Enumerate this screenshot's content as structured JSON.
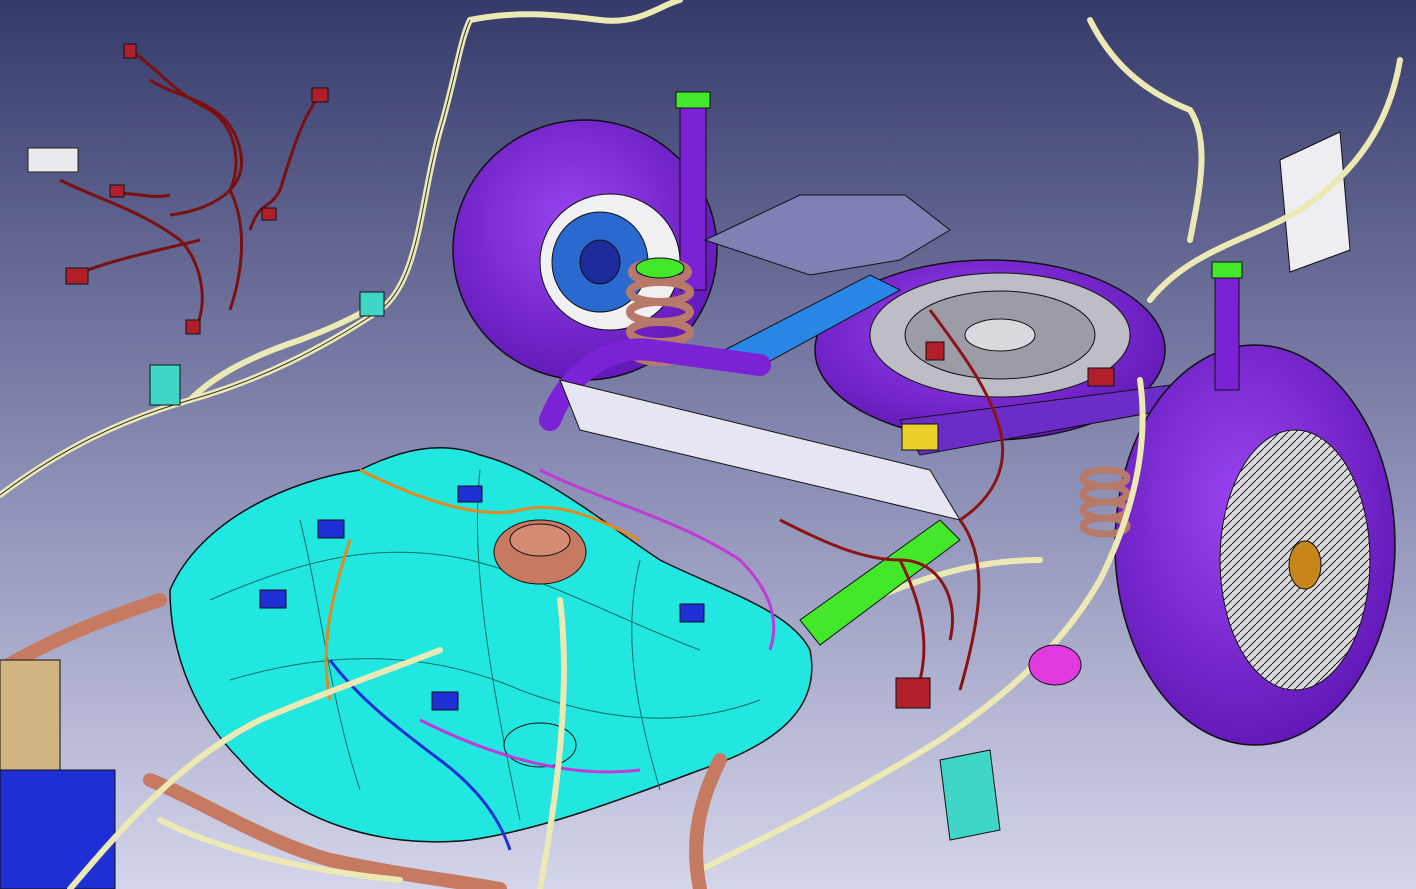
{
  "viewport": {
    "background_top": "#3b3f6e",
    "background_bottom": "#cfd0e6"
  },
  "colors": {
    "fuel_tank": "#22e6e0",
    "tire": "#7b22d6",
    "harness": "#ece9b4",
    "red_harness": "#8a1414",
    "spring": "#b77a6a",
    "exhaust_green": "#44e82a",
    "copper": "#c77a62",
    "plate_blue": "#2a86e6",
    "battery_blue": "#1f2fd6",
    "yellow_bracket": "#e8cf2a",
    "outline": "#0a0a0a"
  },
  "icons": {
    "tank_sender": "fuel-pump-module-icon",
    "wheel": "alloy-wheel-icon",
    "spare": "spare-wheel-icon"
  }
}
